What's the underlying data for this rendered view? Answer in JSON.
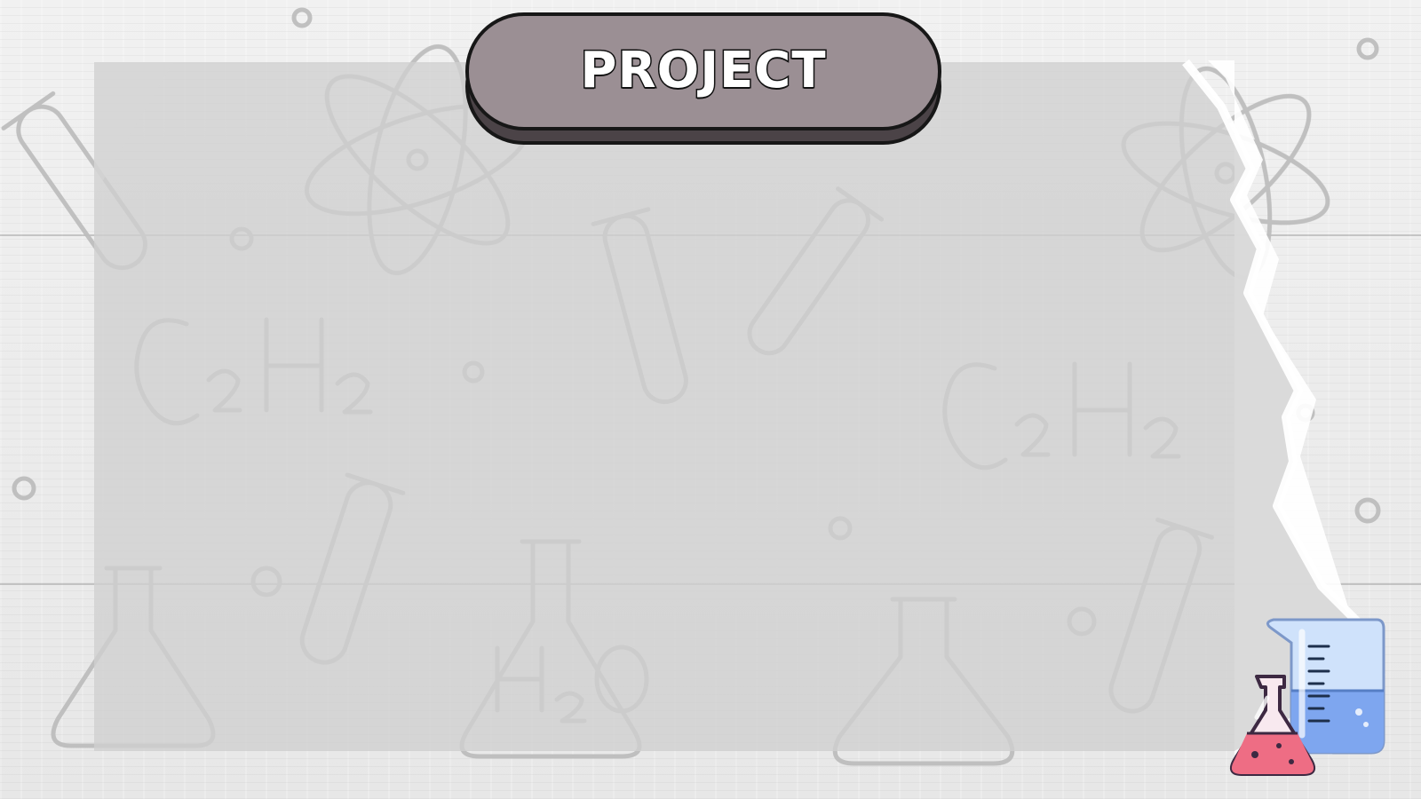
{
  "title": "PROJECT",
  "colors": {
    "background": "#e9e9e9",
    "paper": "#cfcfcf",
    "title_fill": "#9b8f94",
    "title_shadow": "#4b4347",
    "outline": "#171717",
    "beaker_liquid": "#7ea6ef",
    "flask_liquid": "#ee6d84"
  },
  "icons": [
    "atom-icon",
    "test-tube-icon",
    "flask-icon",
    "beaker-icon"
  ]
}
